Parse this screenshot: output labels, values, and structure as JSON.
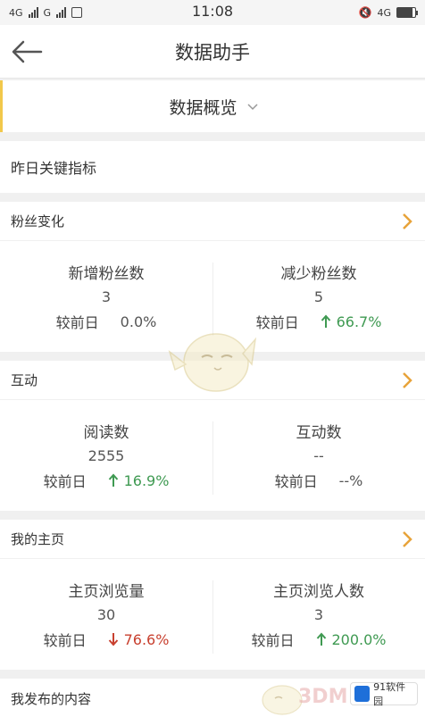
{
  "status_bar": {
    "left_network_1": "4G",
    "left_network_2": "G",
    "time": "11:08",
    "right_network": "4G"
  },
  "nav": {
    "title": "数据助手"
  },
  "selector": {
    "label": "数据概览"
  },
  "key_metrics": {
    "label": "昨日关键指标"
  },
  "sections": [
    {
      "title": "粉丝变化",
      "metrics": [
        {
          "name": "新增粉丝数",
          "value": "3",
          "compare_label": "较前日",
          "change": "0.0%",
          "trend": "none"
        },
        {
          "name": "减少粉丝数",
          "value": "5",
          "compare_label": "较前日",
          "change": "66.7%",
          "trend": "up"
        }
      ]
    },
    {
      "title": "互动",
      "metrics": [
        {
          "name": "阅读数",
          "value": "2555",
          "compare_label": "较前日",
          "change": "16.9%",
          "trend": "up"
        },
        {
          "name": "互动数",
          "value": "--",
          "compare_label": "较前日",
          "change": "--%",
          "trend": "none"
        }
      ]
    },
    {
      "title": "我的主页",
      "metrics": [
        {
          "name": "主页浏览量",
          "value": "30",
          "compare_label": "较前日",
          "change": "76.6%",
          "trend": "down"
        },
        {
          "name": "主页浏览人数",
          "value": "3",
          "compare_label": "较前日",
          "change": "200.0%",
          "trend": "up"
        }
      ]
    }
  ],
  "footer": {
    "label": "我发布的内容"
  },
  "watermark": {
    "brand": "3DM",
    "badge": "91软件园"
  },
  "colors": {
    "accent_arrow": "#e8a33a",
    "up": "#3f9a52",
    "down": "#c8402f",
    "selector_border": "#f2c84b"
  }
}
